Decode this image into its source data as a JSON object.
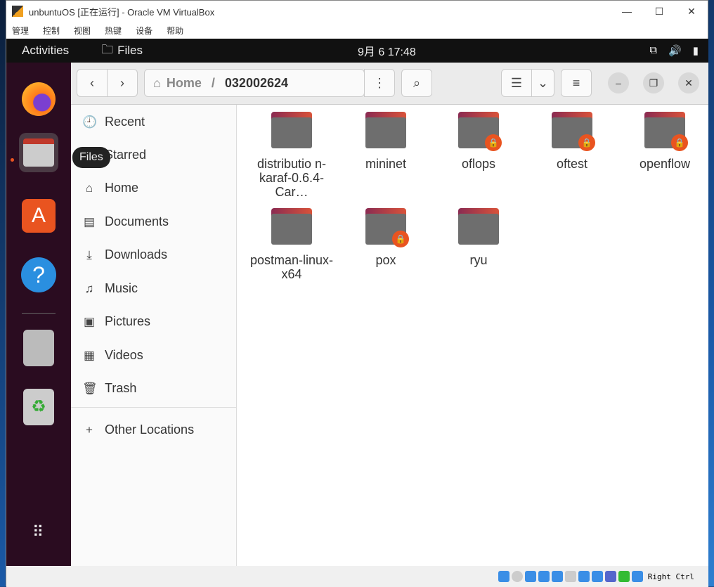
{
  "window": {
    "title": "unbuntuOS [正在运行] - Oracle VM VirtualBox",
    "menu": [
      "管理",
      "控制",
      "视图",
      "热键",
      "设备",
      "帮助"
    ]
  },
  "topbar": {
    "activities": "Activities",
    "app": "Files",
    "clock": "9月 6  17:48"
  },
  "dock": {
    "tooltip": "Files"
  },
  "path": {
    "home": "Home",
    "current": "032002624"
  },
  "sidebar": [
    {
      "icon": "clock-icon",
      "label": "Recent",
      "glyph": "🕘"
    },
    {
      "icon": "star-icon",
      "label": "Starred",
      "glyph": "★"
    },
    {
      "icon": "home-icon",
      "label": "Home",
      "glyph": "⌂"
    },
    {
      "icon": "document-icon",
      "label": "Documents",
      "glyph": "▤"
    },
    {
      "icon": "download-icon",
      "label": "Downloads",
      "glyph": "⤓"
    },
    {
      "icon": "music-icon",
      "label": "Music",
      "glyph": "♫"
    },
    {
      "icon": "picture-icon",
      "label": "Pictures",
      "glyph": "▣"
    },
    {
      "icon": "video-icon",
      "label": "Videos",
      "glyph": "▦"
    },
    {
      "icon": "trash-icon",
      "label": "Trash",
      "glyph": "🗑"
    },
    {
      "icon": "plus-icon",
      "label": "Other Locations",
      "glyph": "+"
    }
  ],
  "files": [
    {
      "name": "distributio n-karaf-0.6.4-Car…",
      "locked": false
    },
    {
      "name": "mininet",
      "locked": false
    },
    {
      "name": "oflops",
      "locked": true
    },
    {
      "name": "oftest",
      "locked": true
    },
    {
      "name": "openflow",
      "locked": true
    },
    {
      "name": "postman-linux-x64",
      "locked": false
    },
    {
      "name": "pox",
      "locked": true
    },
    {
      "name": "ryu",
      "locked": false
    }
  ],
  "statusbar": {
    "host_key": "Right Ctrl"
  }
}
